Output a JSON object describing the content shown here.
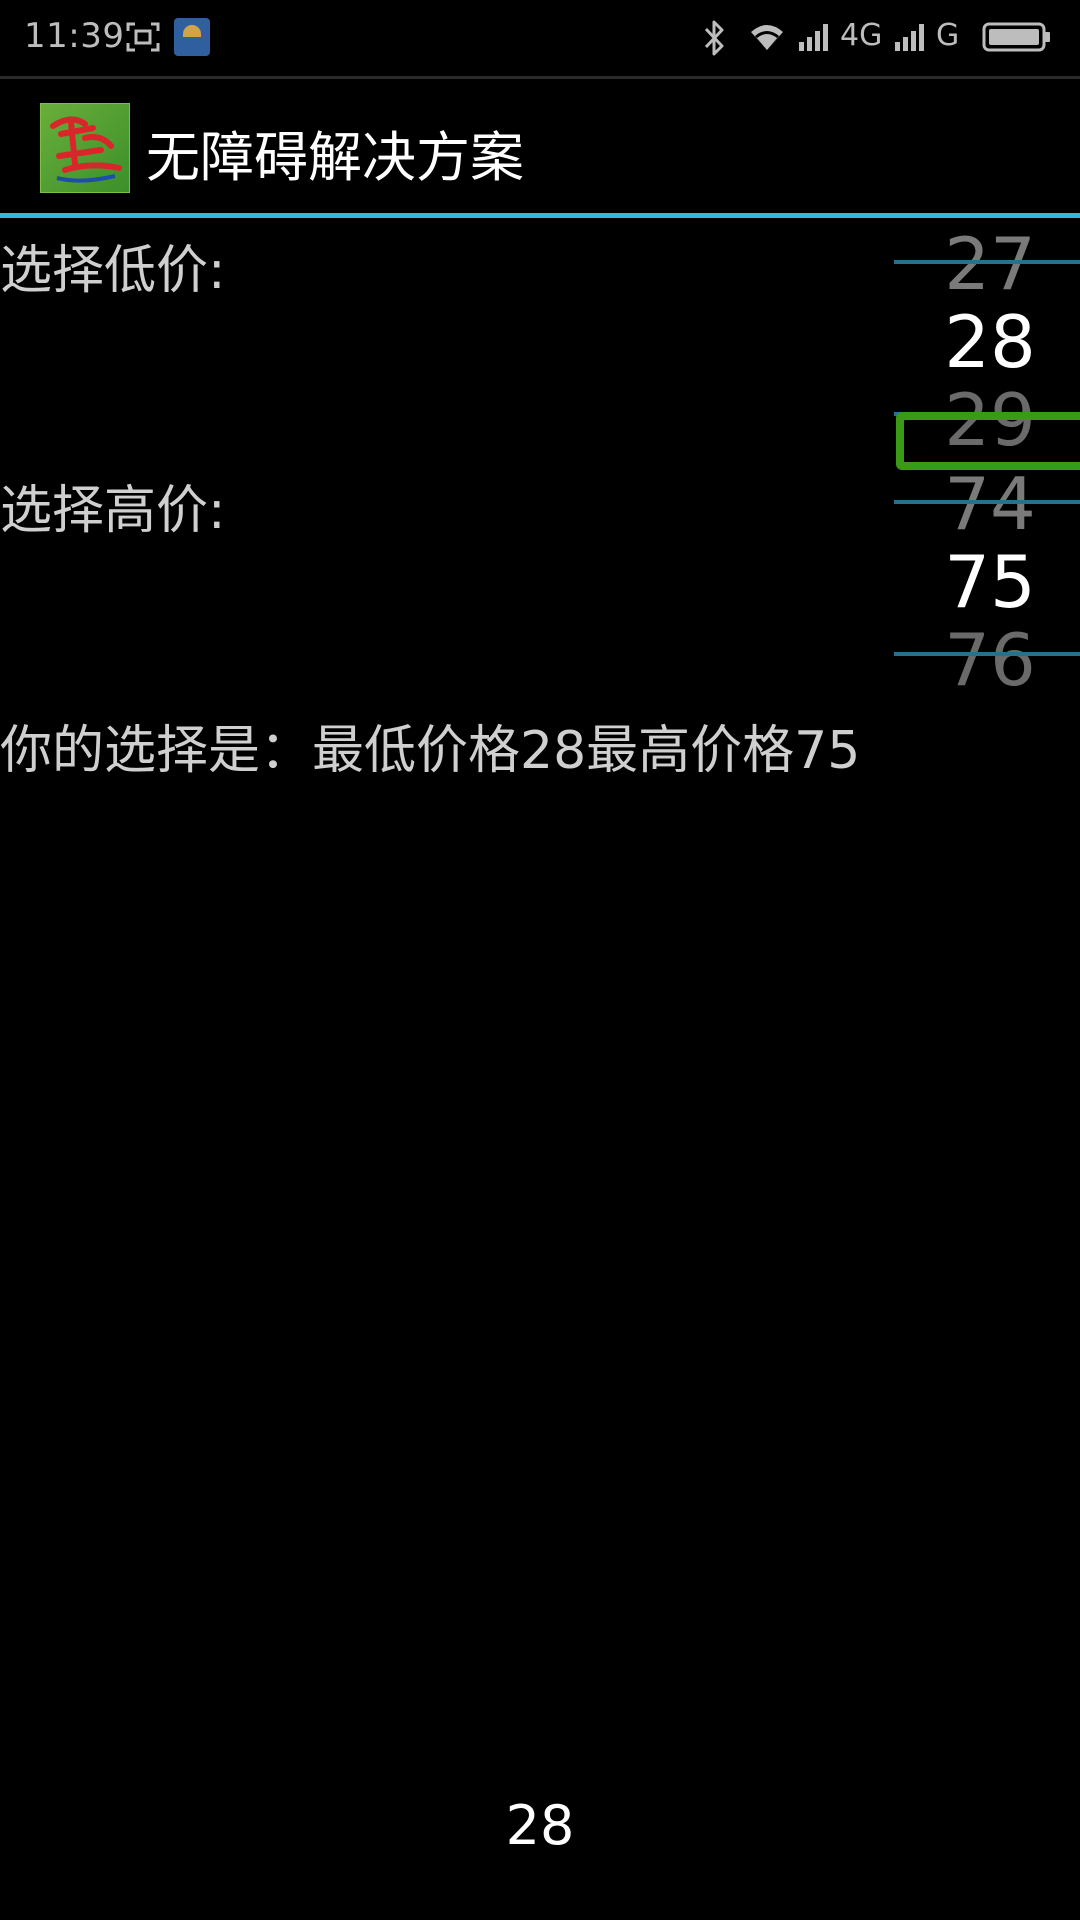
{
  "status_bar": {
    "time": "11:39",
    "network1": "4G",
    "network2": "G",
    "icons": [
      "screenshot-icon",
      "app-mini-icon",
      "bluetooth-icon",
      "wifi-icon",
      "signal-icon",
      "signal-icon",
      "battery-icon"
    ]
  },
  "action_bar": {
    "title": "无障碍解决方案",
    "logo": "app-logo"
  },
  "low_picker": {
    "label": "选择低价:",
    "prev": "27",
    "current": "28",
    "next": "29"
  },
  "high_picker": {
    "label": "选择高价:",
    "prev": "74",
    "current": "75",
    "next": "76"
  },
  "result": {
    "text": "你的选择是：最低价格28最高价格75"
  },
  "toast": {
    "value": "28"
  },
  "colors": {
    "accent": "#33b5e5",
    "focus": "#3a9a17",
    "background": "#000000"
  }
}
